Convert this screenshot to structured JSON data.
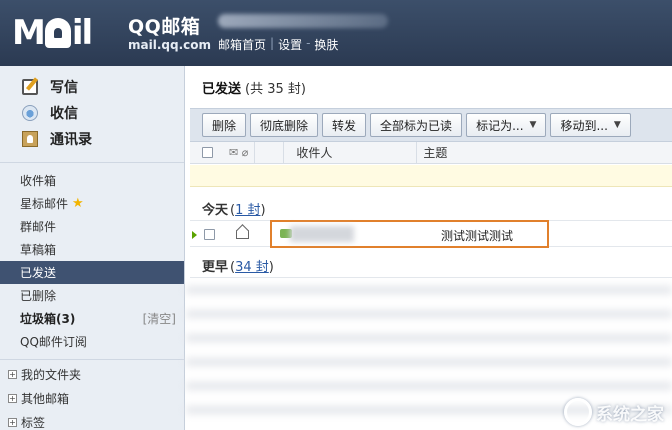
{
  "header": {
    "brand_name": "QQ邮箱",
    "brand_domain": "mail.qq.com",
    "nav": {
      "home": "邮箱首页",
      "settings": "设置",
      "sep": "-",
      "skin": "换肤",
      "bar": "|"
    }
  },
  "sidebar": {
    "actions": [
      {
        "label": "写信",
        "icon": "compose-icon"
      },
      {
        "label": "收信",
        "icon": "inbox-icon"
      },
      {
        "label": "通讯录",
        "icon": "contacts-icon"
      }
    ],
    "folders": [
      {
        "label": "收件箱"
      },
      {
        "label": "星标邮件"
      },
      {
        "label": "群邮件"
      },
      {
        "label": "草稿箱"
      },
      {
        "label": "已发送",
        "active": true
      },
      {
        "label": "已删除"
      },
      {
        "label": "垃圾箱(3)",
        "bold": true,
        "right": "[清空]"
      },
      {
        "label": "QQ邮件订阅"
      }
    ],
    "tree": [
      {
        "label": "我的文件夹",
        "toggle": "+"
      },
      {
        "label": "其他邮箱",
        "toggle": "+"
      },
      {
        "label": "标签",
        "toggle": "+"
      }
    ]
  },
  "main": {
    "title": "已发送",
    "count_text": "(共 35 封)",
    "toolbar": {
      "delete": "删除",
      "purge": "彻底删除",
      "forward": "转发",
      "mark_all_read": "全部标为已读",
      "mark_as": "标记为...",
      "move_to": "移动到..."
    },
    "columns": {
      "recipient": "收件人",
      "subject": "主题"
    },
    "groups": {
      "today": {
        "label": "今天",
        "count_open": "(",
        "count": "1 封",
        "count_close": ")"
      },
      "earlier": {
        "label": "更早",
        "count_open": "(",
        "count": "34 封",
        "count_close": ")"
      }
    },
    "mail": {
      "subject": "测试测试测试"
    }
  },
  "watermark": {
    "text": "系统之家"
  },
  "colors": {
    "header": "#2f3f58",
    "active_folder": "#3f5271",
    "highlight": "#e1802c",
    "link": "#2a5aa5"
  }
}
